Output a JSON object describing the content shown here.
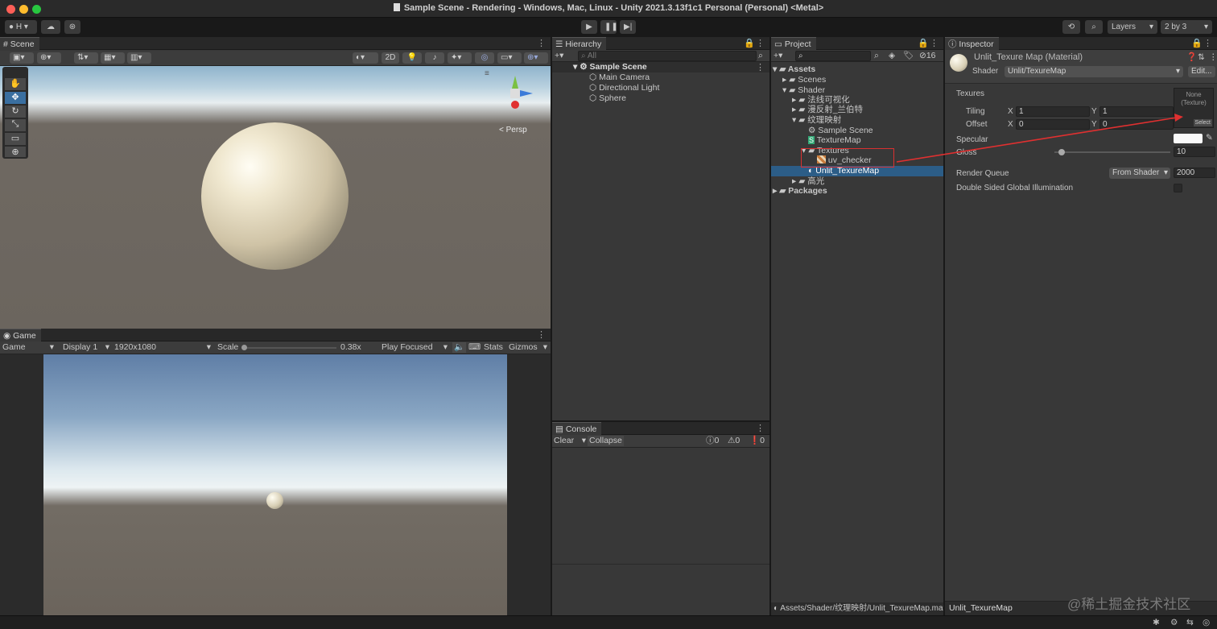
{
  "window": {
    "title": "Sample Scene - Rendering - Windows, Mac, Linux - Unity 2021.3.13f1c1 Personal (Personal) <Metal>"
  },
  "toolbar": {
    "account": "H",
    "layers": "Layers",
    "layout": "2 by 3"
  },
  "scene": {
    "tab": "Scene",
    "mode_2d": "2D",
    "persp": "Persp"
  },
  "game": {
    "tab": "Game",
    "view": "Game",
    "display": "Display 1",
    "resolution": "1920x1080",
    "scale_label": "Scale",
    "scale_value": "0.38x",
    "play_mode": "Play Focused",
    "stats": "Stats",
    "gizmos": "Gizmos"
  },
  "hierarchy": {
    "tab": "Hierarchy",
    "search_placeholder": "All",
    "scene_name": "Sample Scene",
    "items": [
      "Main Camera",
      "Directional Light",
      "Sphere"
    ]
  },
  "console": {
    "tab": "Console",
    "clear": "Clear",
    "collapse": "Collapse",
    "log_count": "0",
    "warn_count": "0",
    "error_count": "0"
  },
  "project": {
    "tab": "Project",
    "hidden_count": "16",
    "tree": {
      "assets": "Assets",
      "scenes": "Scenes",
      "shader": "Shader",
      "folder1": "法线可视化",
      "folder2": "漫反射_兰伯特",
      "folder3": "纹理映射",
      "sample_scene": "Sample Scene",
      "texture_map": "TextureMap",
      "textures": "Textures",
      "uv_checker": "uv_checker",
      "material": "Unlit_TexureMap",
      "folder4": "高光",
      "packages": "Packages"
    },
    "path": "Assets/Shader/纹理映射/Unlit_TexureMap.mat"
  },
  "inspector": {
    "tab": "Inspector",
    "material_name": "Unlit_Texure Map (Material)",
    "shader_label": "Shader",
    "shader_value": "Unlit/TexureMap",
    "edit": "Edit...",
    "texures_label": "Texures",
    "tiling": "Tiling",
    "offset": "Offset",
    "x": "X",
    "y": "Y",
    "tiling_x": "1",
    "tiling_y": "1",
    "offset_x": "0",
    "offset_y": "0",
    "tex_none": "None",
    "tex_type": "(Texture)",
    "select": "Select",
    "specular": "Specular",
    "gloss": "Gloss",
    "gloss_value": "10",
    "gloss_fraction": 0.06,
    "render_queue": "Render Queue",
    "render_queue_mode": "From Shader",
    "render_queue_value": "2000",
    "gi": "Double Sided Global Illumination",
    "footer_name": "Unlit_TexureMap"
  },
  "watermark": "@稀土掘金技术社区",
  "colors": {
    "selection": "#2c5d87",
    "annotation": "#e03030",
    "panel": "#383838"
  }
}
